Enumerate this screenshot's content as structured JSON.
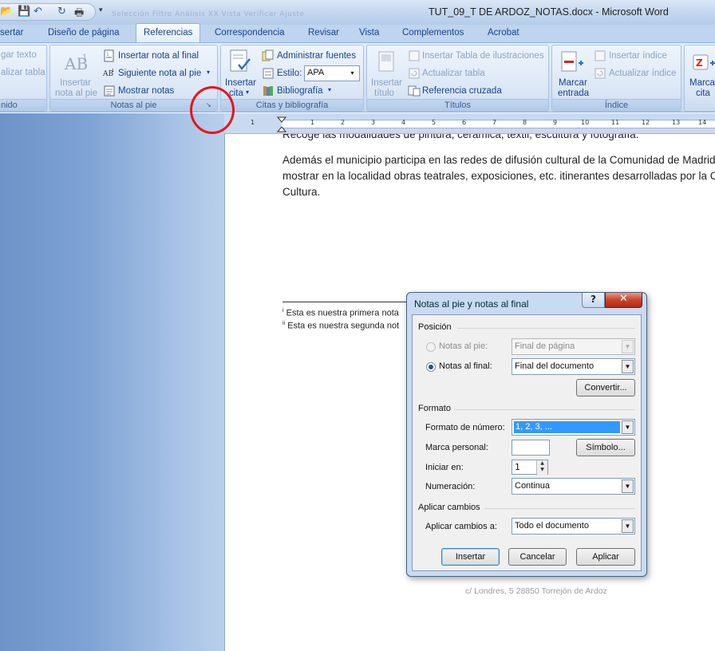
{
  "window": {
    "title": "TUT_09_T DE ARDOZ_NOTAS.docx - Microsoft Word",
    "qat_more": "▾",
    "faded_caption": "Selección   Filtro   Análisis   XX   Vista   Verificar   Ajuste"
  },
  "tabs": [
    {
      "label": "sertar"
    },
    {
      "label": "Diseño de página"
    },
    {
      "label": "Referencias"
    },
    {
      "label": "Correspondencia"
    },
    {
      "label": "Revisar"
    },
    {
      "label": "Vista"
    },
    {
      "label": "Complementos"
    },
    {
      "label": "Acrobat"
    }
  ],
  "ribbon": {
    "tabla_contenido": {
      "agregar_texto": "gar texto",
      "actualizar_tabla": "alizar tabla",
      "group_label": "nido"
    },
    "notas_al_pie": {
      "insertar_nota_pie_1": "Insertar",
      "insertar_nota_pie_2": "nota al pie",
      "insertar_nota_final": "Insertar nota al final",
      "siguiente_nota_pie": "Siguiente nota al pie",
      "mostrar_notas": "Mostrar notas",
      "group_label": "Notas al pie",
      "launcher": "↘"
    },
    "citas": {
      "insertar_cita_1": "Insertar",
      "insertar_cita_2": "cita",
      "administrar_fuentes": "Administrar fuentes",
      "estilo_label": "Estilo:",
      "estilo_value": "APA",
      "bibliografia": "Bibliografía",
      "group_label": "Citas y bibliografía"
    },
    "titulos": {
      "insertar_titulo_1": "Insertar",
      "insertar_titulo_2": "título",
      "insertar_tabla_ilustraciones": "Insertar Tabla de ilustraciones",
      "actualizar_tabla": "Actualizar tabla",
      "referencia_cruzada": "Referencia cruzada",
      "group_label": "Títulos"
    },
    "indice": {
      "marcar_entrada_1": "Marcar",
      "marcar_entrada_2": "entrada",
      "insertar_indice": "Insertar índice",
      "actualizar_indice": "Actualizar índice",
      "group_label": "Índice"
    },
    "tabla_autoridades": {
      "marcar_cita_1": "Marca",
      "marcar_cita_2": "cita"
    }
  },
  "ruler": {
    "numbers": [
      "1",
      "1",
      "2",
      "3",
      "4",
      "5",
      "6",
      "7",
      "8",
      "9",
      "10",
      "11",
      "12",
      "13",
      "14"
    ]
  },
  "document": {
    "line_partial": "Recoge las modalidades de pintura, cerámica, textil, escultura y fotografía.",
    "para_line1": "Además el municipio participa en las redes de difusión cultural de la Comunidad de Madrid,",
    "para_line2": "mostrar en la localidad obras teatrales, exposiciones, etc. itinerantes desarrolladas por la Co",
    "para_line3": "Cultura.",
    "footnote1_mark": "i",
    "footnote1": "Esta  es nuestra  primera nota",
    "footnote2_mark": "ii",
    "footnote2": "Esta  es nuestra  segunda not",
    "footer_address": "c/ Londres, 5   28850 Torrejón de Ardoz"
  },
  "dialog": {
    "title": "Notas al pie y notas al final",
    "help": "?",
    "close": "✕",
    "posicion": {
      "section": "Posición",
      "notas_pie_label": "Notas al pie:",
      "notas_pie_value": "Final de página",
      "notas_final_label": "Notas al final:",
      "notas_final_value": "Final del documento",
      "notas_final_selected": true,
      "convertir": "Convertir..."
    },
    "formato": {
      "section": "Formato",
      "formato_numero_label": "Formato de número:",
      "formato_numero_value": "1, 2, 3, ...",
      "marca_personal_label": "Marca personal:",
      "marca_personal_value": "",
      "simbolo": "Símbolo...",
      "iniciar_en_label": "Iniciar en:",
      "iniciar_en_value": "1",
      "numeracion_label": "Numeración:",
      "numeracion_value": "Continua"
    },
    "aplicar": {
      "section": "Aplicar cambios",
      "aplicar_label": "Aplicar cambios a:",
      "aplicar_value": "Todo el documento"
    },
    "buttons": {
      "insertar": "Insertar",
      "cancelar": "Cancelar",
      "aplicar": "Aplicar"
    }
  },
  "colors": {
    "ribbon_text": "#15428b",
    "annotation_red": "#e8141b",
    "selection_blue": "#3399ff"
  }
}
